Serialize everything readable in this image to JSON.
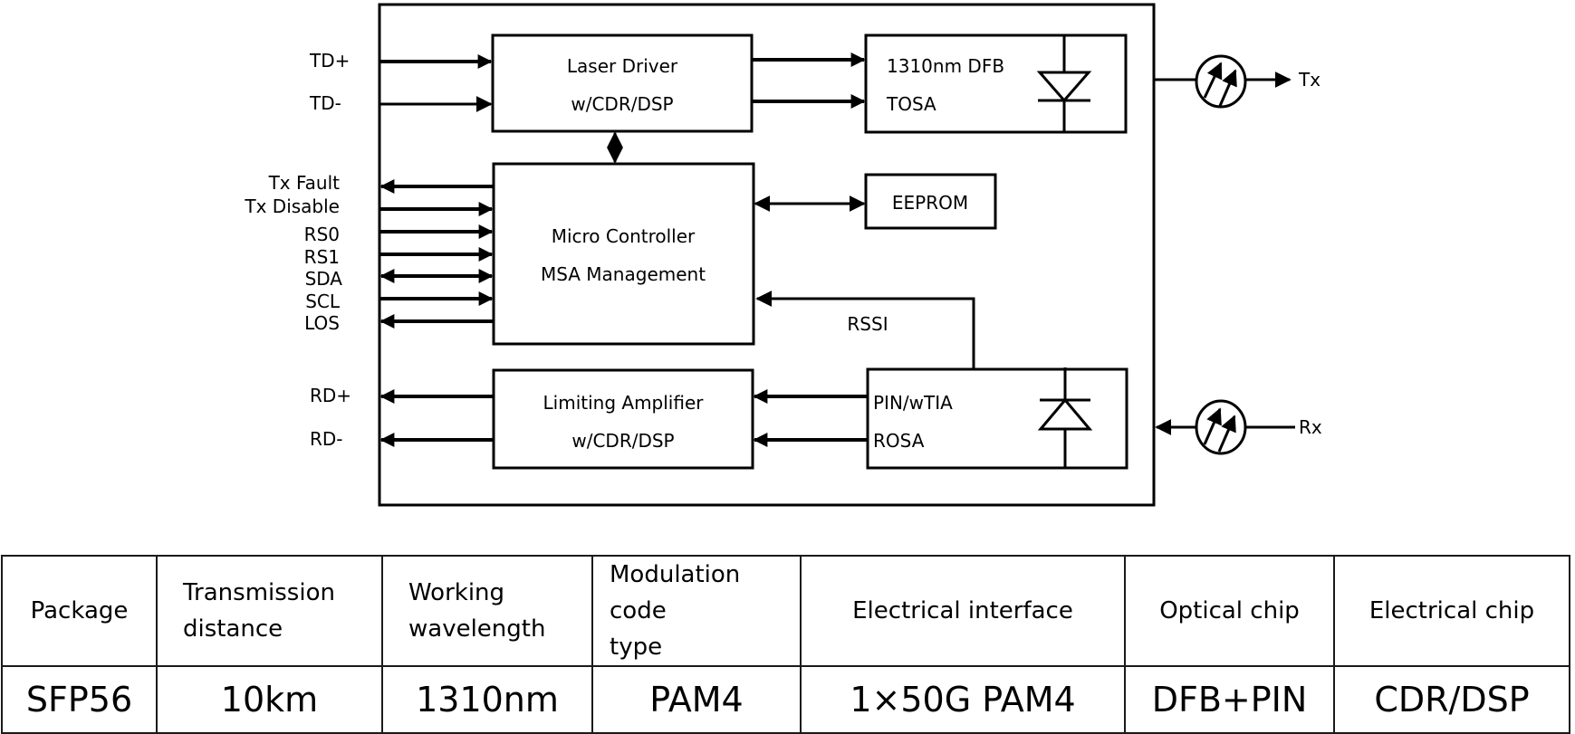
{
  "diagram": {
    "left_signals": {
      "td_plus": "TD+",
      "td_minus": "TD-",
      "tx_fault": "Tx Fault",
      "tx_disable": "Tx Disable",
      "rs0": "RS0",
      "rs1": "RS1",
      "sda": "SDA",
      "scl": "SCL",
      "los": "LOS",
      "rd_plus": "RD+",
      "rd_minus": "RD-"
    },
    "blocks": {
      "laser_driver": {
        "line1": "Laser Driver",
        "line2": "w/CDR/DSP"
      },
      "tosa": {
        "line1": "1310nm DFB",
        "line2": "TOSA"
      },
      "micro_controller": {
        "line1": "Micro Controller",
        "line2": "MSA Management"
      },
      "eeprom": {
        "line1": "EEPROM"
      },
      "limiting_amplifier": {
        "line1": "Limiting Amplifier",
        "line2": "w/CDR/DSP"
      },
      "rosa": {
        "line1": "PIN/wTIA",
        "line2": "ROSA"
      }
    },
    "rssi_label": "RSSI",
    "optical_ports": {
      "tx": "Tx",
      "rx": "Rx"
    }
  },
  "table": {
    "headers": [
      {
        "l1": "Package"
      },
      {
        "l1": "Transmission",
        "l2": "distance"
      },
      {
        "l1": "Working",
        "l2": "wavelength"
      },
      {
        "l1": "Modulation code",
        "l2": "type"
      },
      {
        "l1": "Electrical interface"
      },
      {
        "l1": "Optical chip"
      },
      {
        "l1": "Electrical chip"
      }
    ],
    "values": [
      "SFP56",
      "10km",
      "1310nm",
      "PAM4",
      "1×50G PAM4",
      "DFB+PIN",
      "CDR/DSP"
    ]
  }
}
